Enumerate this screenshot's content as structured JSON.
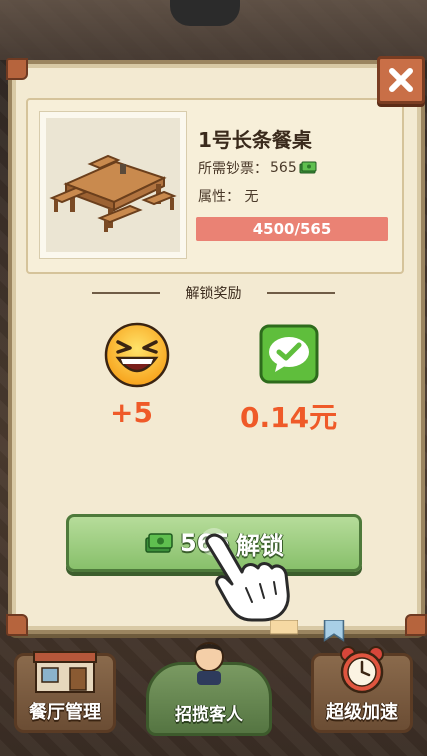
{
  "dialog": {
    "item_name": "1号长条餐桌",
    "cost_label": "所需钞票：",
    "cost_value": "565",
    "attribute_label": "属性：",
    "attribute_value": "无",
    "progress_text": "4500/565",
    "progress_fraction": 1.0,
    "reward_title": "解锁奖励",
    "rewards": [
      {
        "icon": "laughing-emoji-icon",
        "value": "+5"
      },
      {
        "icon": "wechat-check-icon",
        "value": "0.14元"
      }
    ],
    "unlock_button": {
      "amount": "565",
      "label": "解锁"
    },
    "close_icon": "close-icon"
  },
  "bottom_nav": [
    {
      "label": "餐厅管理",
      "icon": "restaurant-building-icon"
    },
    {
      "label": "招揽客人",
      "icon": "chef-character-icon"
    },
    {
      "label": "超级加速",
      "icon": "alarm-clock-icon"
    }
  ],
  "colors": {
    "panel_bg": "#f3ead2",
    "reward_text": "#ef5a28",
    "progress_bar": "#ea8274",
    "unlock_button": "#88c06b",
    "close_button": "#c96f47"
  }
}
